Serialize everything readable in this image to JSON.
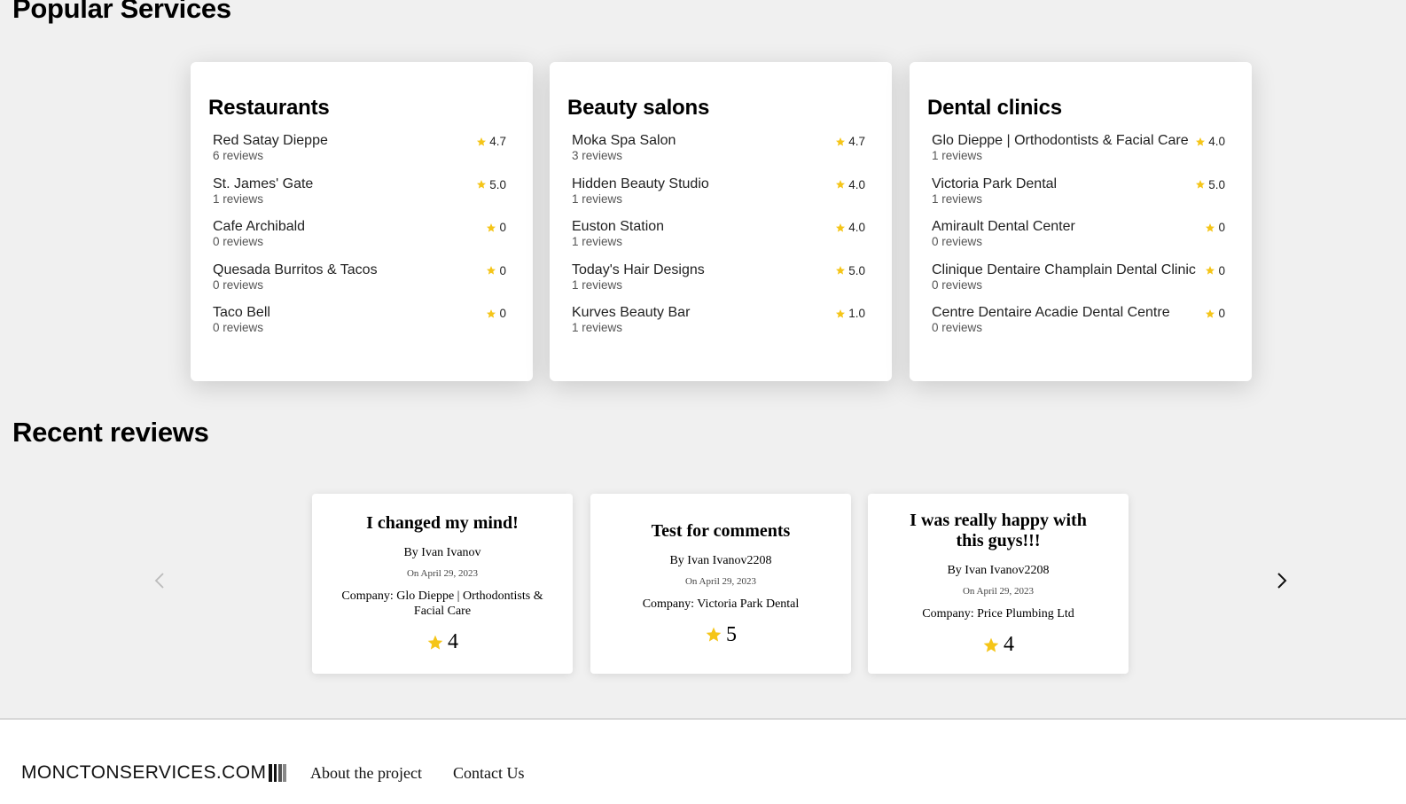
{
  "popular": {
    "title": "Popular Services",
    "categories": [
      {
        "name": "Restaurants",
        "items": [
          {
            "name": "Red Satay Dieppe",
            "reviews": "6 reviews",
            "rating": "4.7"
          },
          {
            "name": "St. James' Gate",
            "reviews": "1 reviews",
            "rating": "5.0"
          },
          {
            "name": "Cafe Archibald",
            "reviews": "0 reviews",
            "rating": "0"
          },
          {
            "name": "Quesada Burritos & Tacos",
            "reviews": "0 reviews",
            "rating": "0"
          },
          {
            "name": "Taco Bell",
            "reviews": "0 reviews",
            "rating": "0"
          }
        ]
      },
      {
        "name": "Beauty salons",
        "items": [
          {
            "name": "Moka Spa Salon",
            "reviews": "3 reviews",
            "rating": "4.7"
          },
          {
            "name": "Hidden Beauty Studio",
            "reviews": "1 reviews",
            "rating": "4.0"
          },
          {
            "name": "Euston Station",
            "reviews": "1 reviews",
            "rating": "4.0"
          },
          {
            "name": "Today's Hair Designs",
            "reviews": "1 reviews",
            "rating": "5.0"
          },
          {
            "name": "Kurves Beauty Bar",
            "reviews": "1 reviews",
            "rating": "1.0"
          }
        ]
      },
      {
        "name": "Dental clinics",
        "items": [
          {
            "name": "Glo Dieppe | Orthodontists & Facial Care",
            "reviews": "1 reviews",
            "rating": "4.0"
          },
          {
            "name": "Victoria Park Dental",
            "reviews": "1 reviews",
            "rating": "5.0"
          },
          {
            "name": "Amirault Dental Center",
            "reviews": "0 reviews",
            "rating": "0"
          },
          {
            "name": "Clinique Dentaire Champlain Dental Clinic",
            "reviews": "0 reviews",
            "rating": "0"
          },
          {
            "name": "Centre Dentaire Acadie Dental Centre",
            "reviews": "0 reviews",
            "rating": "0"
          }
        ]
      }
    ]
  },
  "recent": {
    "title": "Recent reviews",
    "reviews": [
      {
        "title": "I changed my mind!",
        "author": "By Ivan Ivanov",
        "date": "On April 29, 2023",
        "company": "Company: Glo Dieppe | Orthodontists & Facial Care",
        "rating": "4"
      },
      {
        "title": "Test for comments",
        "author": "By Ivan Ivanov2208",
        "date": "On April 29, 2023",
        "company": "Company: Victoria Park Dental",
        "rating": "5"
      },
      {
        "title": "I was really happy with this guys!!!",
        "author": "By Ivan Ivanov2208",
        "date": "On April 29, 2023",
        "company": "Company: Price Plumbing Ltd",
        "rating": "4"
      }
    ],
    "prev_icon": "chevron-left-icon",
    "next_icon": "chevron-right-icon"
  },
  "footer": {
    "brand": "MONCTONSERVICES.COM",
    "links": [
      "About the project",
      "Contact Us"
    ]
  },
  "colors": {
    "star": "#f5c518",
    "background": "#f0f0f0"
  }
}
